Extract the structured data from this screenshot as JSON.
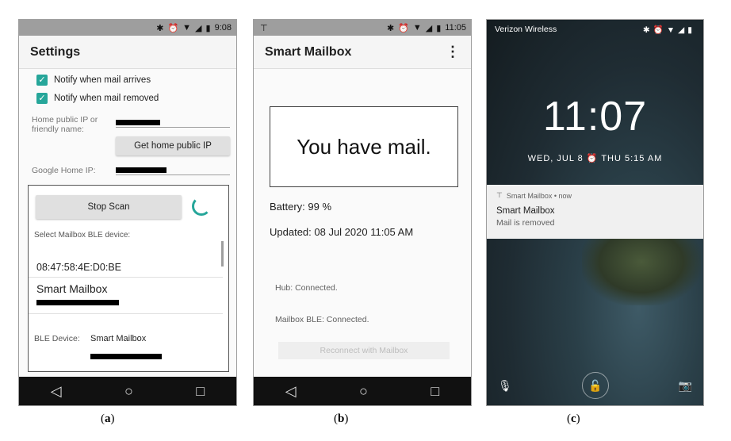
{
  "panel_a": {
    "status_time": "9:08",
    "title": "Settings",
    "checkbox1": "Notify when mail arrives",
    "checkbox2": "Notify when mail removed",
    "home_ip_label": "Home public IP or friendly name:",
    "get_ip_button": "Get home public IP",
    "google_home_label": "Google Home IP:",
    "stop_scan": "Stop Scan",
    "select_label": "Select Mailbox BLE device:",
    "device1": "08:47:58:4E:D0:BE",
    "device2_name": "Smart Mailbox",
    "ble_label": "BLE Device:",
    "ble_value": "Smart Mailbox",
    "caption": "a"
  },
  "panel_b": {
    "status_time": "11:05",
    "title": "Smart Mailbox",
    "menu_icon": "⋮",
    "message": "You have mail.",
    "battery": "Battery: 99 %",
    "updated": "Updated: 08 Jul 2020 11:05 AM",
    "hub": "Hub: Connected.",
    "mailbox_ble": "Mailbox BLE: Connected.",
    "reconnect": "Reconnect with Mailbox",
    "caption": "b"
  },
  "panel_c": {
    "carrier": "Verizon Wireless",
    "clock": "11:07",
    "date_line": "WED, JUL 8 ⏰ THU 5:15 AM",
    "notif_app": "Smart Mailbox • now",
    "notif_title": "Smart Mailbox",
    "notif_body": "Mail is removed",
    "caption": "c"
  },
  "colors": {
    "accent": "#26a69a",
    "statusbar": "#9e9e9e",
    "navbar": "#111111"
  }
}
